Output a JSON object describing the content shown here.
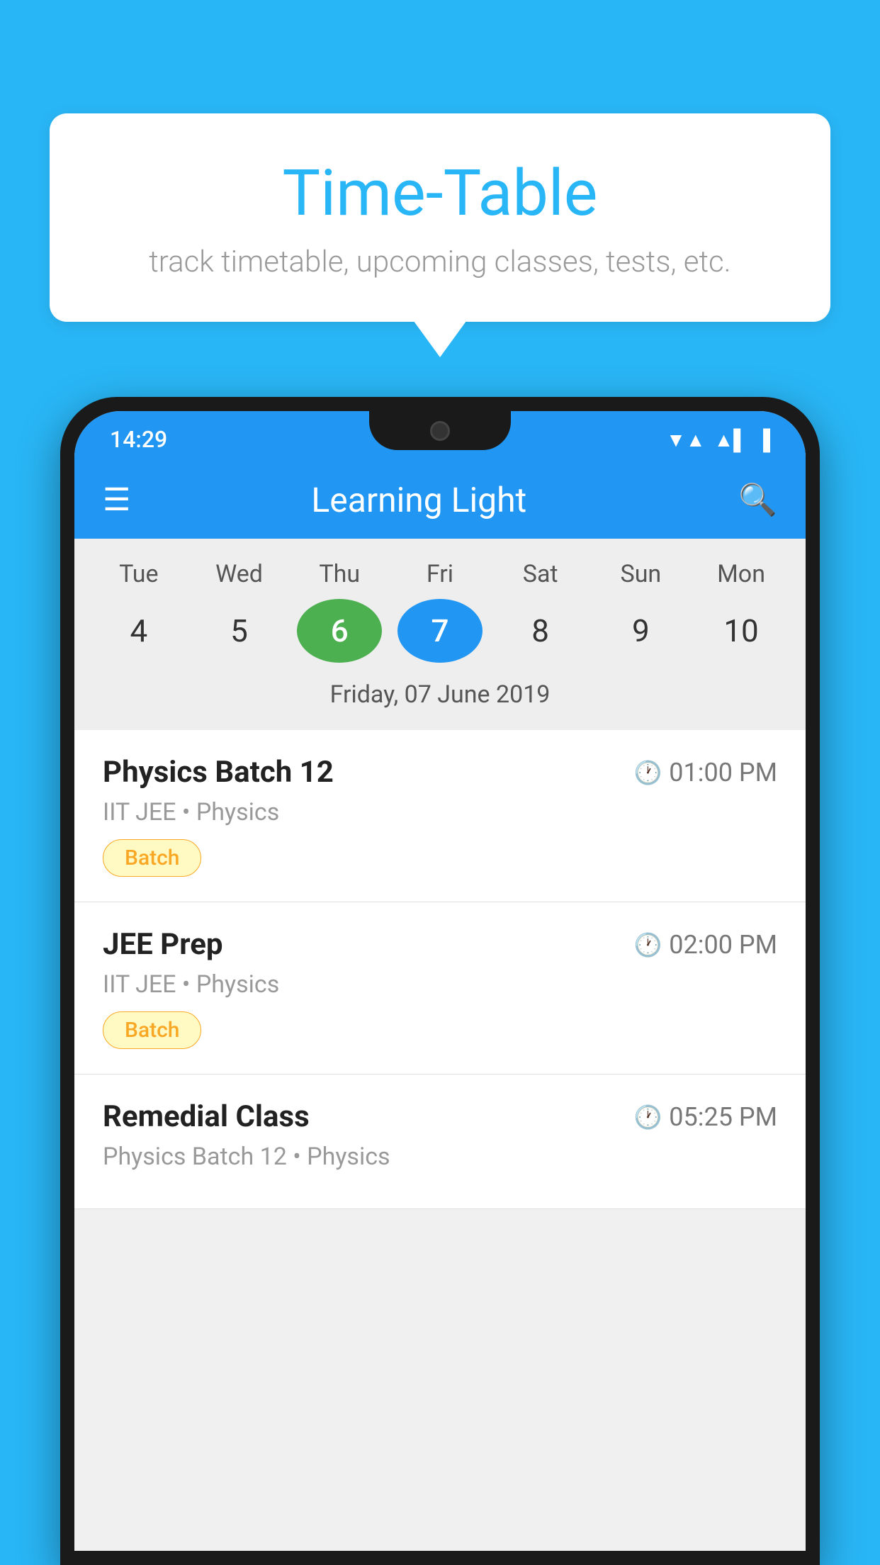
{
  "background_color": "#29B6F6",
  "speech_bubble": {
    "title": "Time-Table",
    "subtitle": "track timetable, upcoming classes, tests, etc."
  },
  "phone": {
    "status_bar": {
      "time": "14:29",
      "icons": [
        "wifi",
        "signal",
        "battery"
      ]
    },
    "app_bar": {
      "title": "Learning Light",
      "menu_icon": "☰",
      "search_icon": "🔍"
    },
    "calendar": {
      "days": [
        {
          "label": "Tue",
          "num": "4"
        },
        {
          "label": "Wed",
          "num": "5"
        },
        {
          "label": "Thu",
          "num": "6",
          "state": "today"
        },
        {
          "label": "Fri",
          "num": "7",
          "state": "selected"
        },
        {
          "label": "Sat",
          "num": "8"
        },
        {
          "label": "Sun",
          "num": "9"
        },
        {
          "label": "Mon",
          "num": "10"
        }
      ],
      "selected_date_label": "Friday, 07 June 2019"
    },
    "classes": [
      {
        "name": "Physics Batch 12",
        "time": "01:00 PM",
        "subtitle": "IIT JEE • Physics",
        "tag": "Batch"
      },
      {
        "name": "JEE Prep",
        "time": "02:00 PM",
        "subtitle": "IIT JEE • Physics",
        "tag": "Batch"
      },
      {
        "name": "Remedial Class",
        "time": "05:25 PM",
        "subtitle": "Physics Batch 12 • Physics",
        "tag": ""
      }
    ]
  }
}
